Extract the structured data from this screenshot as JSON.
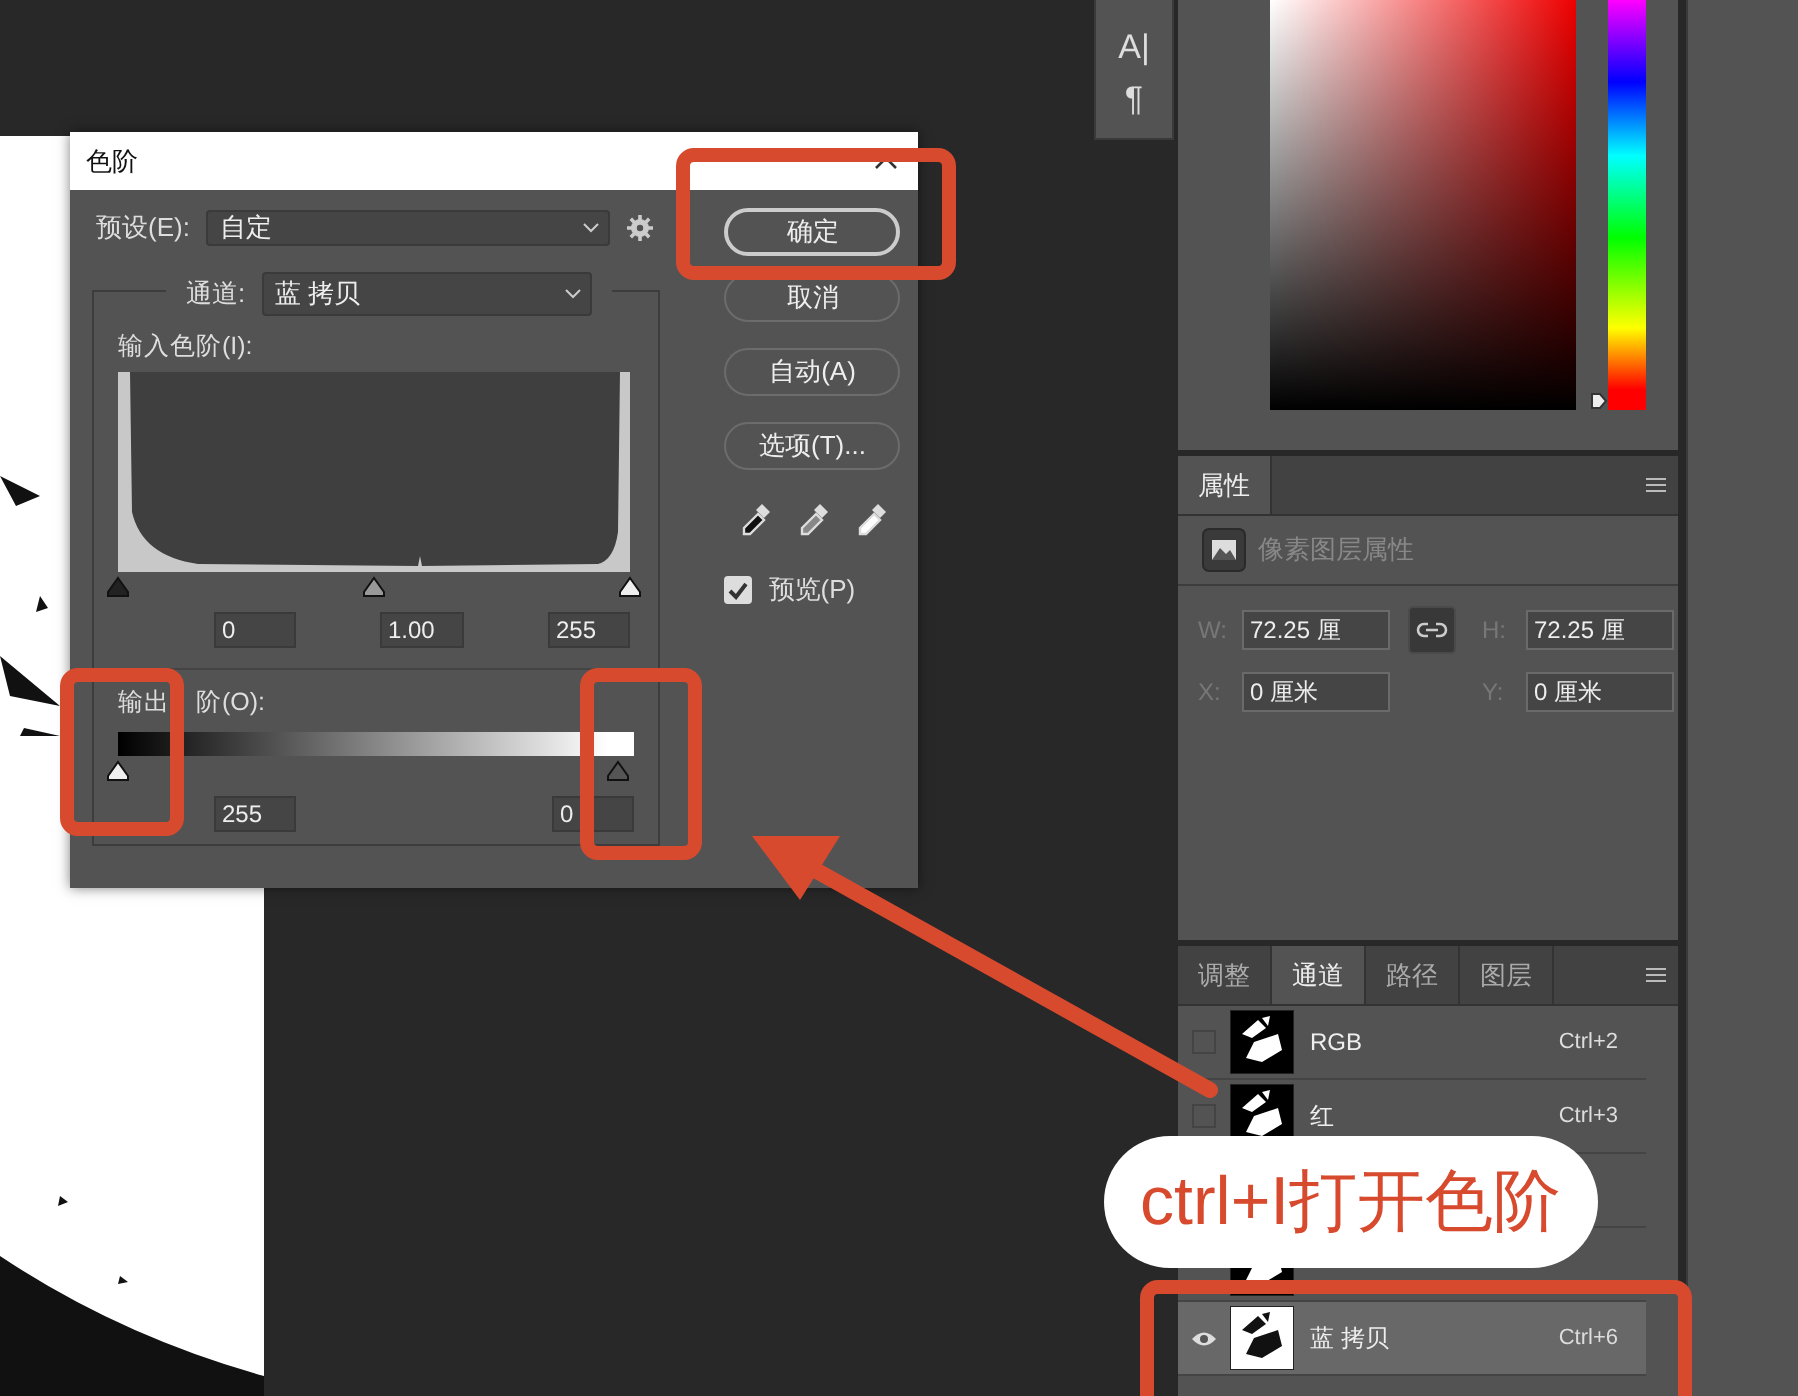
{
  "dialog": {
    "title": "色阶",
    "preset": {
      "label": "预设(E):",
      "value": "自定"
    },
    "channel": {
      "label": "通道:",
      "value": "蓝 拷贝"
    },
    "input_levels": {
      "label": "输入色阶(I):",
      "values": [
        "0",
        "1.00",
        "255"
      ]
    },
    "output_levels": {
      "label_start": "输出",
      "label_end": "阶(O):",
      "values": [
        "255",
        "0"
      ]
    },
    "buttons": [
      {
        "label": "确定",
        "default": true
      },
      {
        "label": "取消",
        "default": false
      },
      {
        "label": "自动(A)",
        "default": false
      },
      {
        "label": "选项(T)...",
        "default": false
      }
    ],
    "preview": {
      "label": "预览(P)",
      "checked": true
    }
  },
  "color_picker": {
    "hue": {
      "level": 0
    }
  },
  "tools": [
    {
      "glyph": "A|"
    },
    {
      "glyph": "¶"
    }
  ],
  "properties": {
    "tab": "属性",
    "subtitle": "像素图层属性",
    "fields": [
      {
        "label": "W:",
        "value": "72.25 厘"
      },
      {
        "label": "H:",
        "value": "72.25 厘"
      },
      {
        "label": "X:",
        "value": "0 厘米"
      },
      {
        "label": "Y:",
        "value": "0 厘米"
      }
    ]
  },
  "channels_panel": {
    "tabs": [
      {
        "label": "调整",
        "selected": false
      },
      {
        "label": "通道",
        "selected": true
      },
      {
        "label": "路径",
        "selected": false
      },
      {
        "label": "图层",
        "selected": false
      }
    ],
    "rows": [
      {
        "name": "RGB",
        "shortcut": "Ctrl+2",
        "visible": false,
        "selected": false
      },
      {
        "name": "红",
        "shortcut": "Ctrl+3",
        "visible": false,
        "selected": false
      },
      {
        "selected": false
      },
      {
        "selected": false
      },
      {
        "name": "蓝 拷贝",
        "shortcut": "Ctrl+6",
        "visible": true,
        "selected": true
      }
    ]
  },
  "annotation": {
    "text": "ctrl+I打开色阶"
  }
}
